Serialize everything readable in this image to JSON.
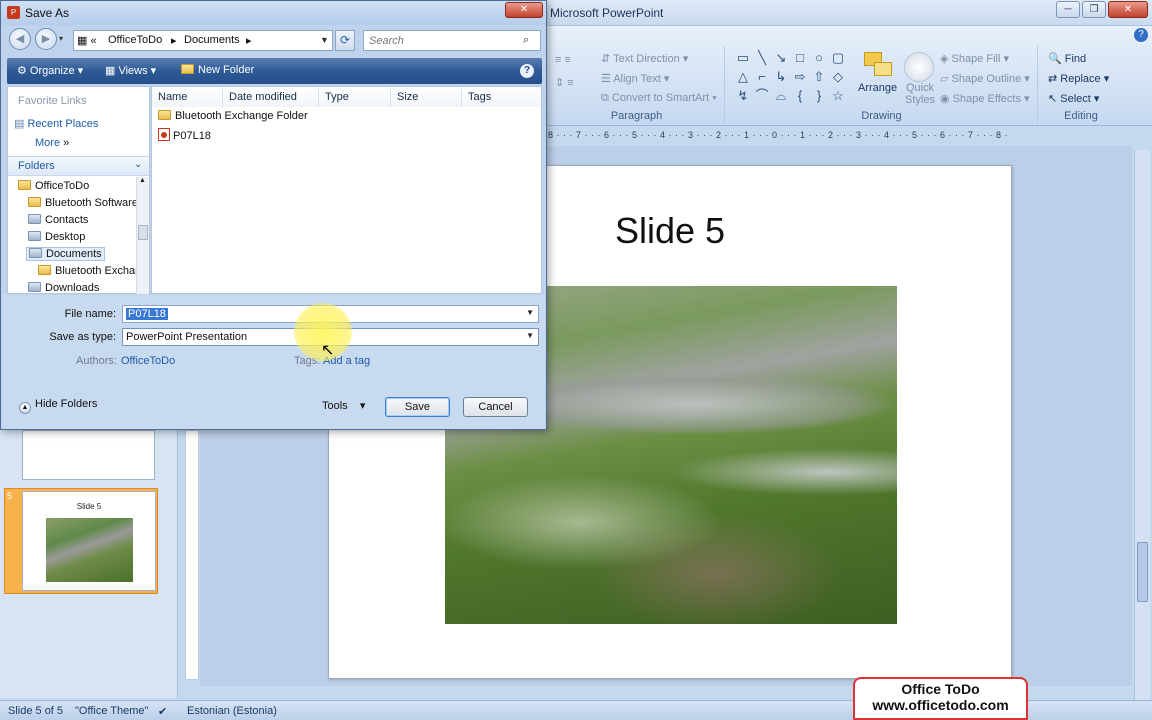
{
  "ppt": {
    "title": "Microsoft PowerPoint",
    "help": "?",
    "paragraph": {
      "label": "Paragraph",
      "text_direction": "Text Direction",
      "align_text": "Align Text",
      "convert_smartart": "Convert to SmartArt"
    },
    "drawing": {
      "label": "Drawing",
      "arrange": "Arrange",
      "quick_styles": "Quick Styles",
      "shape_fill": "Shape Fill",
      "shape_outline": "Shape Outline",
      "shape_effects": "Shape Effects"
    },
    "editing": {
      "label": "Editing",
      "find": "Find",
      "replace": "Replace",
      "select": "Select"
    },
    "ruler": "8 · · · 7 · · · 6 · · · 5 · · · 4 · · · 3 · · · 2 · · · 1 · · · 0 · · · 1 · · · 2 · · · 3 · · · 4 · · · 5 · · · 6 · · · 7 · · · 8 · · · 9 · · · 10 · · · 11 · · · 12",
    "slide_title": "Slide 5",
    "thumb_number": "5",
    "thumb_title": "Slide 5",
    "status": {
      "slide": "Slide 5 of 5",
      "theme": "\"Office Theme\"",
      "language": "Estonian (Estonia)"
    },
    "watermark": {
      "line1": "Office ToDo",
      "line2": "www.officetodo.com"
    }
  },
  "dialog": {
    "title": "Save As",
    "breadcrumb": {
      "root": "OfficeToDo",
      "folder": "Documents"
    },
    "search_placeholder": "Search",
    "toolbar": {
      "organize": "Organize",
      "views": "Views",
      "new_folder": "New Folder"
    },
    "nav": {
      "favorite_links": "Favorite Links",
      "recent_places": "Recent Places",
      "more": "More",
      "folders": "Folders",
      "tree": [
        "OfficeToDo",
        "Bluetooth Software",
        "Contacts",
        "Desktop",
        "Documents",
        "Bluetooth Exchange Folder",
        "Downloads"
      ]
    },
    "columns": [
      "Name",
      "Date modified",
      "Type",
      "Size",
      "Tags"
    ],
    "files": [
      {
        "name": "Bluetooth Exchange Folder",
        "kind": "folder-icon"
      },
      {
        "name": "P07L18",
        "kind": "pptx-file-icon"
      }
    ],
    "file_name_label": "File name:",
    "file_name": "P07L18",
    "save_type_label": "Save as type:",
    "save_type": "PowerPoint Presentation",
    "authors_label": "Authors:",
    "authors": "OfficeToDo",
    "tags_label": "Tags:",
    "tags_value": "Add a tag",
    "hide_folders": "Hide Folders",
    "tools": "Tools",
    "save": "Save",
    "cancel": "Cancel"
  }
}
